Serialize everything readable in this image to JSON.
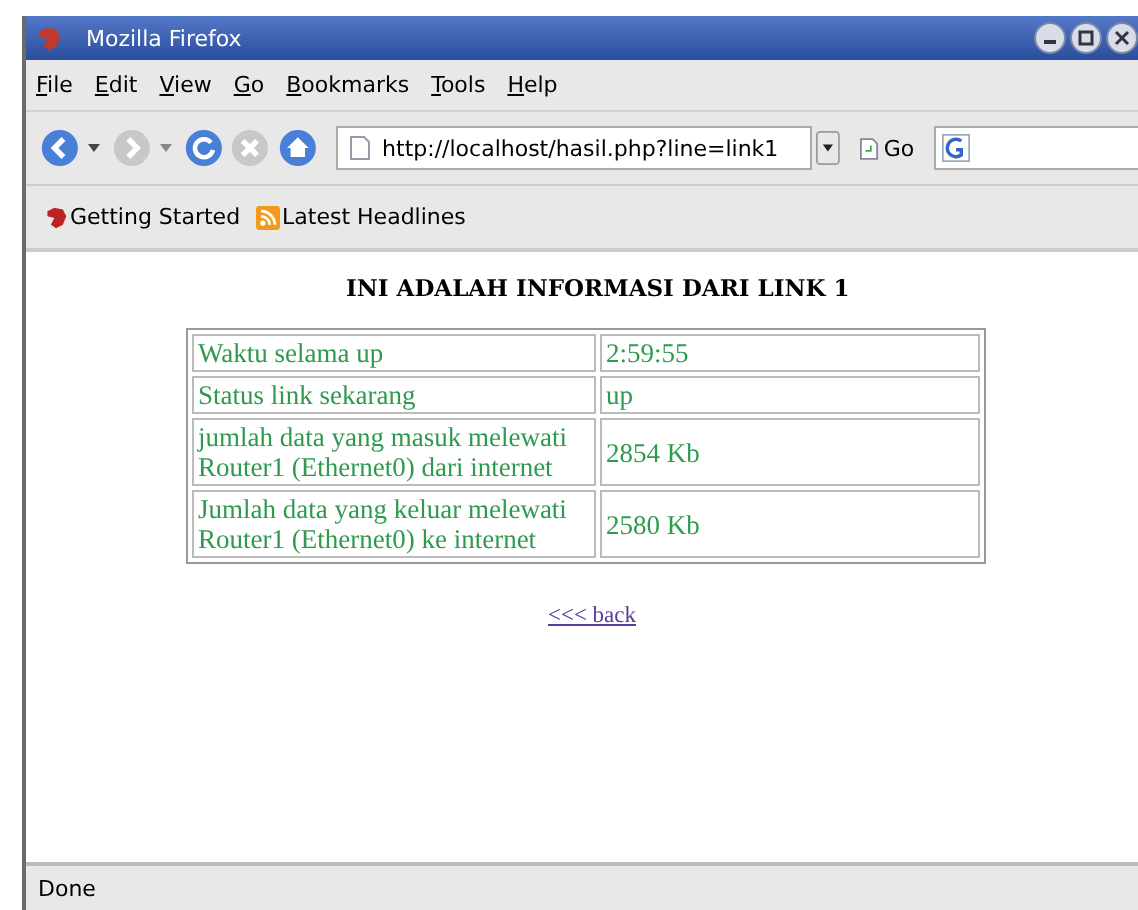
{
  "window": {
    "title": "Mozilla Firefox"
  },
  "menu": [
    "File",
    "Edit",
    "View",
    "Go",
    "Bookmarks",
    "Tools",
    "Help"
  ],
  "navigation": {
    "url": "http://localhost/hasil.php?line=link1",
    "go_label": "Go"
  },
  "bookmarks": [
    {
      "label": "Getting Started",
      "kind": "page"
    },
    {
      "label": "Latest Headlines",
      "kind": "feed"
    }
  ],
  "page": {
    "heading": "INI ADALAH INFORMASI DARI LINK 1",
    "rows": [
      {
        "label": "Waktu selama up",
        "value": "2:59:55"
      },
      {
        "label": "Status link sekarang",
        "value": "up"
      },
      {
        "label": "jumlah data yang masuk melewati Router1 (Ethernet0) dari internet",
        "value": "2854 Kb"
      },
      {
        "label": "Jumlah data yang keluar melewati Router1 (Ethernet0) ke internet",
        "value": "2580 Kb"
      }
    ],
    "link": "<<< back"
  },
  "status_bar": "Done"
}
